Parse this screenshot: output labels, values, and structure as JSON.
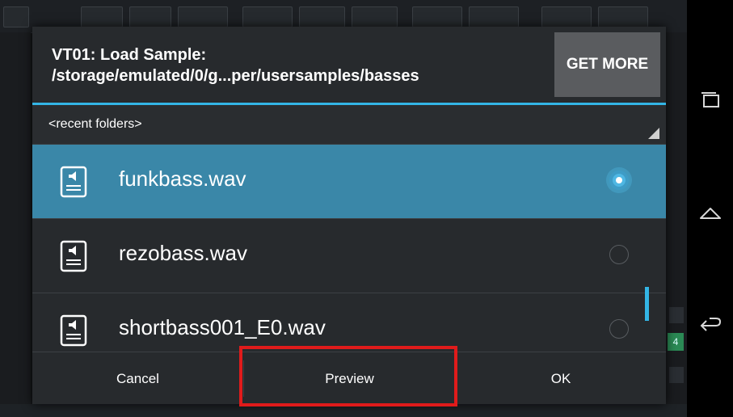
{
  "dialog": {
    "title": "VT01: Load Sample:\n/storage/emulated/0/g...per/usersamples/basses",
    "get_more_label": "GET MORE",
    "recent_folders_label": "<recent folders>"
  },
  "files": [
    {
      "name": "funkbass.wav",
      "selected": true
    },
    {
      "name": "rezobass.wav",
      "selected": false
    },
    {
      "name": "shortbass001_E0.wav",
      "selected": false
    }
  ],
  "buttons": {
    "cancel": "Cancel",
    "preview": "Preview",
    "ok": "OK"
  },
  "background": {
    "green_badge": "4"
  },
  "colors": {
    "accent": "#33b5e5",
    "selected_row": "#3a87a8",
    "highlight": "#e01b1b"
  },
  "icons": {
    "file": "audio-file-icon",
    "nav": [
      "recent-apps-icon",
      "home-icon",
      "back-icon"
    ]
  }
}
